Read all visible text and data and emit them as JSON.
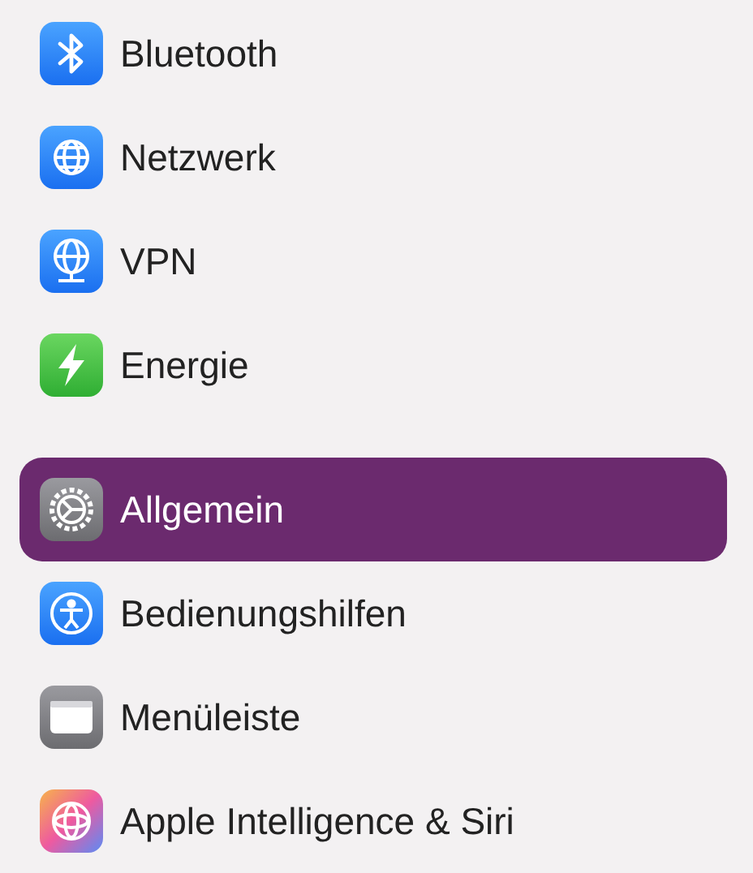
{
  "sidebar": {
    "groups": [
      {
        "items": [
          {
            "label": "Bluetooth",
            "selected": false
          },
          {
            "label": "Netzwerk",
            "selected": false
          },
          {
            "label": "VPN",
            "selected": false
          },
          {
            "label": "Energie",
            "selected": false
          }
        ]
      },
      {
        "items": [
          {
            "label": "Allgemein",
            "selected": true
          },
          {
            "label": "Bedienungshilfen",
            "selected": false
          },
          {
            "label": "Menüleiste",
            "selected": false
          },
          {
            "label": "Apple Intelligence & Siri",
            "selected": false
          }
        ]
      }
    ]
  }
}
